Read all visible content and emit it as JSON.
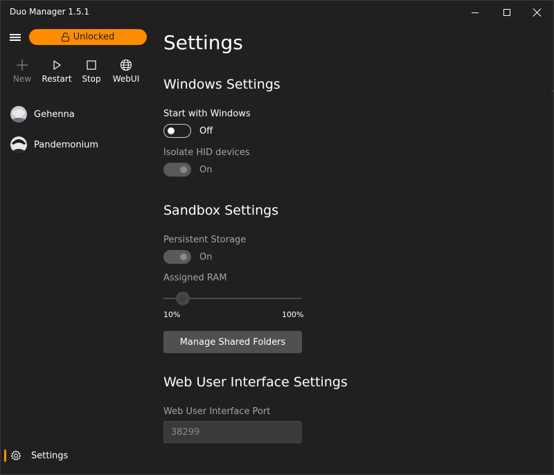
{
  "app": {
    "title": "Duo Manager 1.5.1"
  },
  "colors": {
    "accent": "#ff8c00",
    "background": "#202020"
  },
  "sidebar": {
    "lock_button_label": "Unlocked",
    "toolbar": [
      {
        "label": "New",
        "icon": "plus-icon",
        "enabled": false
      },
      {
        "label": "Restart",
        "icon": "play-icon",
        "enabled": true
      },
      {
        "label": "Stop",
        "icon": "stop-icon",
        "enabled": true
      },
      {
        "label": "WebUI",
        "icon": "globe-icon",
        "enabled": true
      }
    ],
    "profiles": [
      {
        "name": "Gehenna"
      },
      {
        "name": "Pandemonium"
      }
    ],
    "settings_label": "Settings"
  },
  "main": {
    "title": "Settings",
    "windows_section": {
      "title": "Windows Settings",
      "start_with_windows": {
        "label": "Start with Windows",
        "state": "Off"
      },
      "isolate_hid": {
        "label": "Isolate HID devices",
        "state": "On"
      }
    },
    "sandbox_section": {
      "title": "Sandbox Settings",
      "persistent_storage": {
        "label": "Persistent Storage",
        "state": "On"
      },
      "assigned_ram": {
        "label": "Assigned RAM",
        "min_label": "10%",
        "max_label": "100%",
        "value_fraction": 0.1
      },
      "manage_button": "Manage Shared Folders"
    },
    "web_section": {
      "title": "Web User Interface Settings",
      "port_label": "Web User Interface Port",
      "port_value": "38299"
    }
  }
}
